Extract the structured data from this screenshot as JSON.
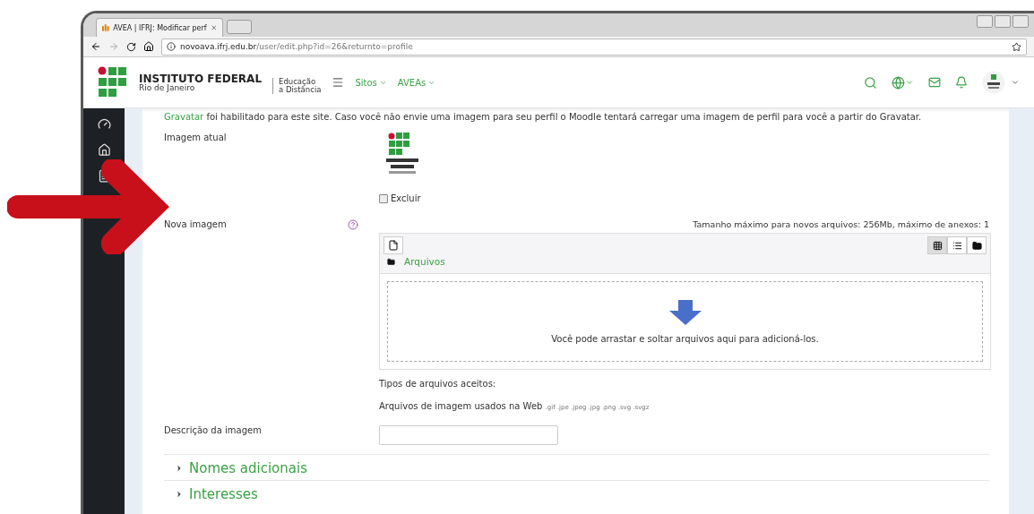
{
  "browser": {
    "tab_title": "AVEA | IFRJ: Modificar perf",
    "url_host": "novoava.ifrj.edu.br",
    "url_path": "/user/edit.php?id=26&returnto=profile"
  },
  "header": {
    "logo_title": "INSTITUTO FEDERAL",
    "logo_subtitle": "Rio de Janeiro",
    "division": [
      "Educação",
      "a Distância"
    ],
    "nav": [
      {
        "label": "Sitos"
      },
      {
        "label": "AVEAs"
      }
    ]
  },
  "intro": {
    "link": "Gravatar",
    "text": " foi habilitado para este site. Caso você não envie uma imagem para seu perfil o Moodle tentará carregar uma imagem de perfil para você a partir do Gravatar."
  },
  "current_image": {
    "label": "Imagem atual",
    "delete": {
      "label": "Excluir",
      "checked": false
    }
  },
  "new_image": {
    "label": "Nova imagem",
    "limits": "Tamanho máximo para novos arquivos: 256Mb, máximo de anexos: 1",
    "path": "Arquivos",
    "views": [
      {
        "kind": "grid",
        "selected": true
      },
      {
        "kind": "list",
        "selected": false
      },
      {
        "kind": "tree",
        "selected": false
      }
    ],
    "drop_text": "Você pode arrastar e soltar arquivos aqui para adicioná-los.",
    "accepted_label": "Tipos de arquivos aceitos:",
    "accepted_text": "Arquivos de imagem usados na Web",
    "extensions": ".gif .jpe .jpeg .jpg .png .svg .svgz"
  },
  "description": {
    "label": "Descrição da imagem"
  },
  "sections": [
    {
      "label": "Nomes adicionais",
      "expanded": false
    },
    {
      "label": "Interesses",
      "expanded": false
    }
  ]
}
